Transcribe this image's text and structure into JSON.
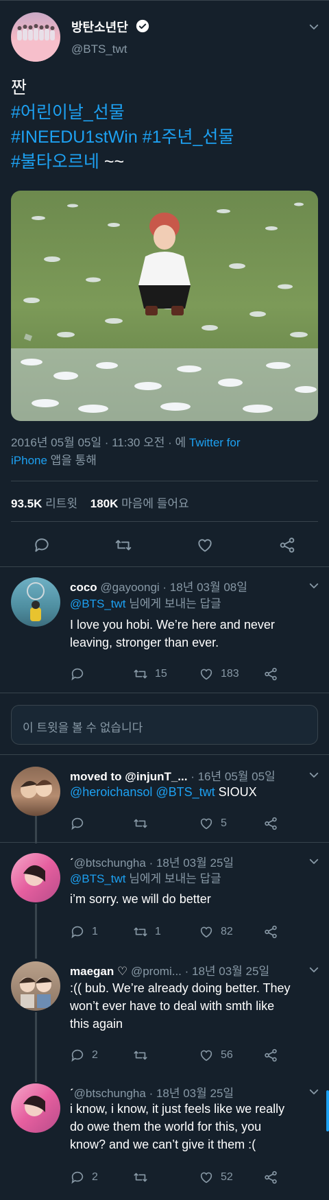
{
  "tweet": {
    "display_name": "방탄소년단",
    "handle": "@BTS_twt",
    "text_line1": "짠",
    "hashtag1": "#어린이날_선물",
    "hashtag2": "#INEEDU1stWin",
    "hashtag3": "#1주년_선물",
    "hashtag4": "#불타오르네",
    "text_tail": " ~~",
    "meta_prefix": "2016년 05월 05일 · 11:30 오전 · 에 ",
    "meta_app_line1": "Twitter for",
    "meta_app_line2": "iPhone",
    "meta_suffix": " 앱을 통해",
    "retweets_count": "93.5K",
    "retweets_label": " 리트윗",
    "likes_count": "180K",
    "likes_label": " 마음에 들어요"
  },
  "replies": [
    {
      "name": "coco",
      "handle": "@gayoongi",
      "date": " · 18년 03월 08일",
      "reply_to": "@BTS_twt",
      "reply_suffix": " 님에게 보내는 답글",
      "text_line1": "I love you hobi. We’re here and never",
      "text_line2": "leaving, stronger than ever.",
      "reply_count": "",
      "retweet_count": "15",
      "like_count": "183"
    },
    {
      "unavailable": "이 트윗을 볼 수 없습니다"
    },
    {
      "name": "moved to @injunT_...",
      "date": " · 16년 05월 05일",
      "mention1": "@heroichansol",
      "mention2": "@BTS_twt",
      "text": " SIOUX",
      "like_count": "5"
    },
    {
      "name_prefix": "ˊ",
      "handle": "@btschungha",
      "date": " · 18년 03월 25일",
      "reply_to": "@BTS_twt",
      "reply_suffix": " 님에게 보내는 답글",
      "text": "i’m sorry. we will do better",
      "reply_count": "1",
      "retweet_count": "1",
      "like_count": "82"
    },
    {
      "name": "maegan ♡",
      "handle": "@promi...",
      "date": " · 18년 03월 25일",
      "text_line1": ":(( bub. We’re already doing better. They",
      "text_line2": "won’t ever have to deal with smth like",
      "text_line3": "this again",
      "reply_count": "2",
      "like_count": "56"
    },
    {
      "name_prefix": "ˊ",
      "handle": "@btschungha",
      "date": " · 18년 03월 25일",
      "text_line1": "i know, i know, it just feels like we really",
      "text_line2": "do owe them the world for this, you",
      "text_line3": "know? and we can’t give it them :(",
      "reply_count": "2",
      "like_count": "52"
    }
  ],
  "colors": {
    "background": "#15202b",
    "accent": "#1da1f2",
    "muted": "#8899a6",
    "divider": "#38444d"
  },
  "icons": [
    "verified-icon",
    "chevron-down-icon",
    "reply-icon",
    "retweet-icon",
    "like-icon",
    "share-icon"
  ]
}
